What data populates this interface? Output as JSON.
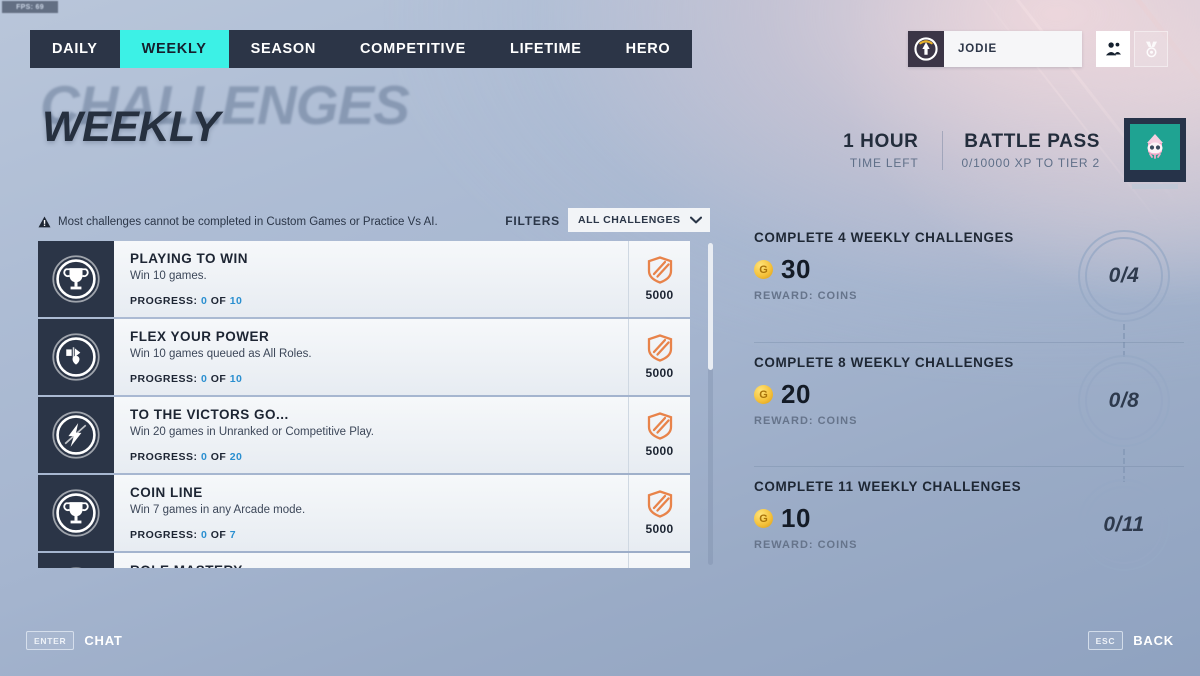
{
  "hud": {
    "fps_label": "FPS: 69"
  },
  "nav": {
    "tabs": [
      {
        "label": "DAILY",
        "active": false
      },
      {
        "label": "WEEKLY",
        "active": true
      },
      {
        "label": "SEASON",
        "active": false
      },
      {
        "label": "COMPETITIVE",
        "active": false
      },
      {
        "label": "LIFETIME",
        "active": false
      },
      {
        "label": "HERO",
        "active": false
      }
    ],
    "active_accent": "#3cf1e6",
    "bar_color": "#2c3547"
  },
  "account": {
    "player_name": "JODIE",
    "avatar_icon": "overwatch-logo-icon",
    "social_icon": "friends-icon",
    "medal_icon": "medal-icon"
  },
  "page": {
    "ghost_title": "CHALLENGES",
    "title": "WEEKLY"
  },
  "battle_pass": {
    "timer_value": "1 HOUR",
    "timer_label": "TIME LEFT",
    "pass_title": "BATTLE PASS",
    "pass_progress": "0/10000 XP TO TIER 2",
    "tile_icon": "battle-pass-character-icon",
    "tile_color": "#1fa392"
  },
  "filters": {
    "warning_icon": "warning-triangle-icon",
    "warning_text": "Most challenges cannot be completed in Custom Games or Practice Vs AI.",
    "filters_label": "FILTERS",
    "selected": "ALL CHALLENGES",
    "chevron_icon": "chevron-down-icon"
  },
  "challenges": {
    "progress_prefix": "PROGRESS:",
    "progress_joiner": "OF",
    "items": [
      {
        "icon": "trophy-icon",
        "title": "PLAYING TO WIN",
        "description": "Win 10 games.",
        "progress_current": "0",
        "progress_total": "10",
        "xp_icon": "xp-shield-icon",
        "xp_value": "5000"
      },
      {
        "icon": "all-roles-icon",
        "title": "FLEX YOUR POWER",
        "description": "Win 10 games queued as All Roles.",
        "progress_current": "0",
        "progress_total": "10",
        "xp_icon": "xp-shield-icon",
        "xp_value": "5000"
      },
      {
        "icon": "lightning-bolt-icon",
        "title": "TO THE VICTORS GO...",
        "description": "Win 20 games in Unranked or Competitive Play.",
        "progress_current": "0",
        "progress_total": "20",
        "xp_icon": "xp-shield-icon",
        "xp_value": "5000"
      },
      {
        "icon": "trophy-icon",
        "title": "COIN LINE",
        "description": "Win 7 games in any Arcade mode.",
        "progress_current": "0",
        "progress_total": "7",
        "xp_icon": "xp-shield-icon",
        "xp_value": "5000"
      },
      {
        "icon": "trophy-icon",
        "title": "ROLE MASTERY",
        "description": "",
        "progress_current": "",
        "progress_total": "",
        "xp_icon": "xp-shield-icon",
        "xp_value": ""
      }
    ]
  },
  "rewards": {
    "coin_icon": "coin-icon",
    "blocks": [
      {
        "title": "COMPLETE 4 WEEKLY CHALLENGES",
        "amount": "30",
        "reward_label": "REWARD:  COINS",
        "node_label": "0/4"
      },
      {
        "title": "COMPLETE 8 WEEKLY CHALLENGES",
        "amount": "20",
        "reward_label": "REWARD:  COINS",
        "node_label": "0/8"
      },
      {
        "title": "COMPLETE 11 WEEKLY CHALLENGES",
        "amount": "10",
        "reward_label": "REWARD:  COINS",
        "node_label": "0/11"
      }
    ]
  },
  "footer": {
    "chat_key": "ENTER",
    "chat_label": "CHAT",
    "back_key": "ESC",
    "back_label": "BACK"
  }
}
